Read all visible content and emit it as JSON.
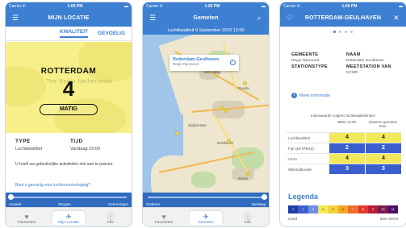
{
  "colors": {
    "accent": "#3d7fd1",
    "yellow": "#f7f089",
    "blue_cell": "#3c5fcf",
    "yellow_cell": "#f2e85a"
  },
  "status": {
    "carrier": "Carrier ✆",
    "time": "1:05 PM",
    "battery": "▬"
  },
  "phone1": {
    "title": "MIJN LOCATIE",
    "tabs": [
      {
        "label": "KWALITEIT",
        "active": true
      },
      {
        "label": "GEVOELIG",
        "active": false
      }
    ],
    "city": "ROTTERDAM",
    "index": "4",
    "rating": "MATIG",
    "watermark": "The Regio  Netherlands",
    "info": {
      "type_label": "TYPE",
      "type_value": "Luchtkwaliteit",
      "time_label": "TIJD",
      "time_value": "Vandaag 15:00"
    },
    "description": "U hoeft uw gebruikelijke activiteiten niet aan te passen.",
    "description2": "Bent u gevoelig voor luchtverontreiniging?",
    "timeline": {
      "labels": [
        "Actueel",
        "Morgen",
        "Overmorgen"
      ],
      "position": 0.0
    }
  },
  "phone2": {
    "title": "Gemeten",
    "banner": "Luchtkwaliteit 9 September 2015 12:00",
    "card": {
      "title": "Rotterdam-Geulhaven",
      "subtitle": "Regio Rijnmond",
      "info": "i"
    },
    "labels": [
      "Dordrecht",
      "Gouda",
      "Spijkenisse",
      "Rotterdam",
      "Den Haag",
      "Breda"
    ],
    "timeline": {
      "labels": [
        "Gisteren",
        "Vandaag"
      ],
      "position": 1.0
    }
  },
  "phone3": {
    "title": "ROTTERDAM-GEULHAVEN",
    "pager": {
      "count": 4,
      "active": 0
    },
    "kv": {
      "gemeente_label": "GEMEENTE",
      "gemeente_value": "Regio Rijnmond",
      "naam_label": "NAAM",
      "naam_value": "Rotterdam Geulhaven",
      "stationstype_label": "STATIONSTYPE",
      "stationstype_value": "",
      "meetstation_label": "MEETSTATION VAN",
      "meetstation_value": "DCMR"
    },
    "more": "Meer informatie",
    "index_header": "Indexwaarde volgens luchtkwaliteitindex",
    "table_head": [
      "WED 13:00",
      "Gisteren gemeten max."
    ],
    "rows": [
      {
        "name": "Luchtkwaliteit",
        "now": "4",
        "max": "4",
        "now_color": "yellow",
        "max_color": "yellow"
      },
      {
        "name": "Fijn stof (PM10)",
        "now": "2",
        "max": "2",
        "now_color": "blue",
        "max_color": "blue"
      },
      {
        "name": "Ozon",
        "now": "4",
        "max": "4",
        "now_color": "yellow",
        "max_color": "yellow"
      },
      {
        "name": "Stikstofdioxide",
        "now": "3",
        "max": "3",
        "now_color": "blue",
        "max_color": "blue"
      }
    ],
    "legend": {
      "title": "Legenda",
      "left": "Goed",
      "right": "Zeer slecht",
      "steps": [
        {
          "n": "1",
          "c": "#1f3fa8"
        },
        {
          "n": "2",
          "c": "#3c5fcf"
        },
        {
          "n": "3",
          "c": "#6d8fe6"
        },
        {
          "n": "4",
          "c": "#f2e85a"
        },
        {
          "n": "5",
          "c": "#f7d23a"
        },
        {
          "n": "6",
          "c": "#f5a623"
        },
        {
          "n": "7",
          "c": "#ef6c2a"
        },
        {
          "n": "8",
          "c": "#e2392f"
        },
        {
          "n": "9",
          "c": "#b81e34"
        },
        {
          "n": "10",
          "c": "#7a1a52"
        },
        {
          "n": "11",
          "c": "#4a0f66"
        }
      ]
    }
  },
  "tabbar": [
    {
      "label": "Favorieten",
      "icon": "heart-icon"
    },
    {
      "label": "Mijn Locatie",
      "icon": "pin-icon"
    },
    {
      "label": "Gemeten",
      "icon": "pin-icon"
    },
    {
      "label": "Info",
      "icon": "info-icon"
    }
  ]
}
